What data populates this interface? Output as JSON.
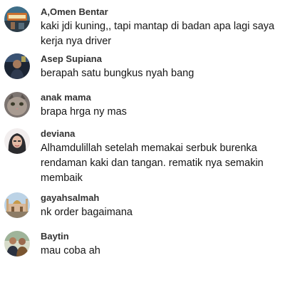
{
  "comments": [
    {
      "username": "A,Omen Bentar",
      "text": "kaki jdi kuning,, tapi mantap di badan apa lagi saya kerja nya driver",
      "avatar": "avatar-signboard-photo"
    },
    {
      "username": "Asep Supiana",
      "text": "berapah satu bungkus nyah bang",
      "avatar": "avatar-person-night-photo"
    },
    {
      "username": "anak mama",
      "text": "brapa hrga ny mas",
      "avatar": "avatar-cat-photo"
    },
    {
      "username": "deviana",
      "text": "Alhamdulillah setelah memakai serbuk burenka rendaman kaki dan tangan. rematik nya semakin membaik",
      "avatar": "avatar-woman-hijab-photo"
    },
    {
      "username": "gayahsalmah",
      "text": "nk order bagaimana",
      "avatar": "avatar-mosque-photo"
    },
    {
      "username": "Baytin",
      "text": "mau coba ah",
      "avatar": "avatar-couple-photo"
    }
  ]
}
